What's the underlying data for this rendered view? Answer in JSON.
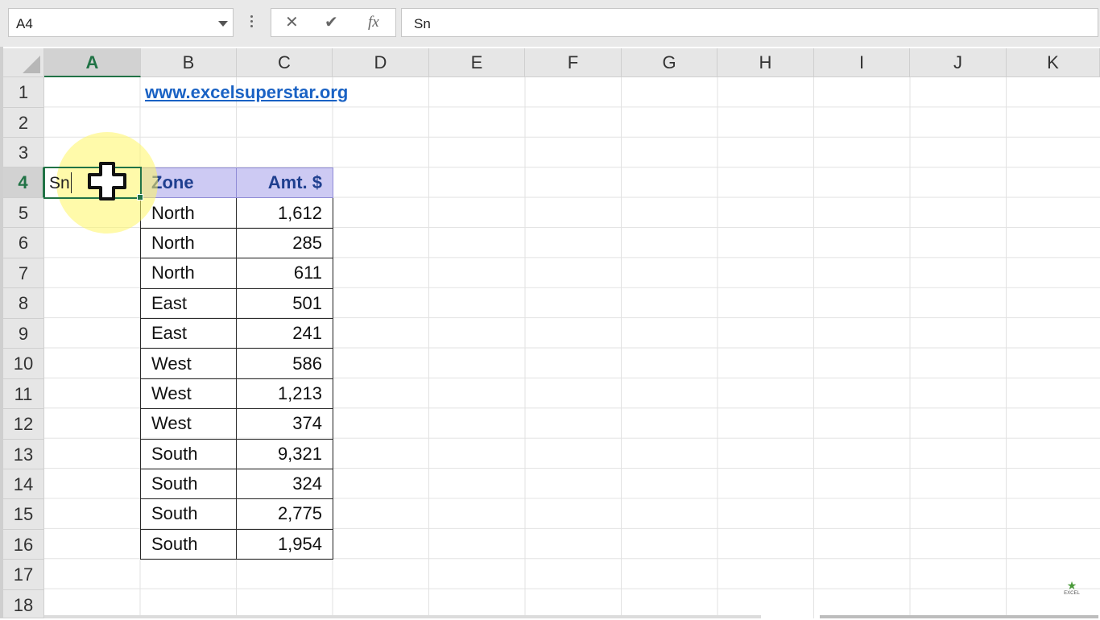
{
  "name_box": {
    "value": "A4"
  },
  "formula_bar": {
    "cancel_icon": "✕",
    "enter_icon": "✔",
    "fx_label": "fx",
    "value": "Sn"
  },
  "columns": [
    "A",
    "B",
    "C",
    "D",
    "E",
    "F",
    "G",
    "H",
    "I",
    "J",
    "K"
  ],
  "selected_column": "A",
  "rows": [
    "1",
    "2",
    "3",
    "4",
    "5",
    "6",
    "7",
    "8",
    "9",
    "10",
    "11",
    "12",
    "13",
    "14",
    "15",
    "16",
    "17",
    "18"
  ],
  "selected_row": "4",
  "cells": {
    "B1": "www.excelsuperstar.org",
    "A4": "Sn"
  },
  "table": {
    "headers": {
      "zone": "Zone",
      "amount": "Amt. $"
    },
    "rows": [
      {
        "zone": "North",
        "amount": "1,612"
      },
      {
        "zone": "North",
        "amount": "285"
      },
      {
        "zone": "North",
        "amount": "611"
      },
      {
        "zone": "East",
        "amount": "501"
      },
      {
        "zone": "East",
        "amount": "241"
      },
      {
        "zone": "West",
        "amount": "586"
      },
      {
        "zone": "West",
        "amount": "1,213"
      },
      {
        "zone": "West",
        "amount": "374"
      },
      {
        "zone": "South",
        "amount": "9,321"
      },
      {
        "zone": "South",
        "amount": "324"
      },
      {
        "zone": "South",
        "amount": "2,775"
      },
      {
        "zone": "South",
        "amount": "1,954"
      }
    ]
  },
  "colors": {
    "accent": "#217346",
    "header_fill": "#cdcaf3",
    "header_text": "#1f3f8f",
    "link": "#1a62c4"
  },
  "icons": {
    "cursor": "crosshair-plus-icon",
    "watermark": "excel-superstar-logo-icon"
  },
  "watermark": {
    "text": "EXCEL"
  }
}
